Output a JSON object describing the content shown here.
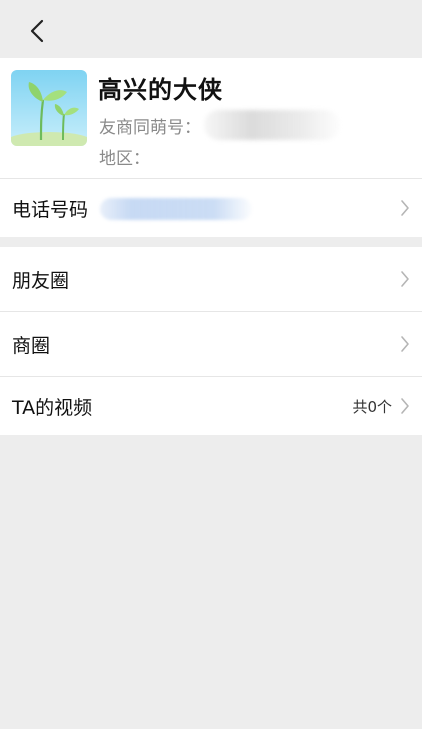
{
  "profile": {
    "name": "高兴的大侠",
    "id_label": "友商同萌号：",
    "region_label": "地区："
  },
  "rows": {
    "phone_label": "电话号码",
    "moments_label": "朋友圈",
    "business_label": "商圈",
    "video_label": "TA的视频",
    "video_count": "共0个"
  },
  "icons": {
    "back": "back-arrow-icon",
    "chevron": "chevron-right-icon"
  },
  "colors": {
    "background": "#ededed",
    "card": "#ffffff",
    "secondary_text": "#8a8a8a"
  }
}
